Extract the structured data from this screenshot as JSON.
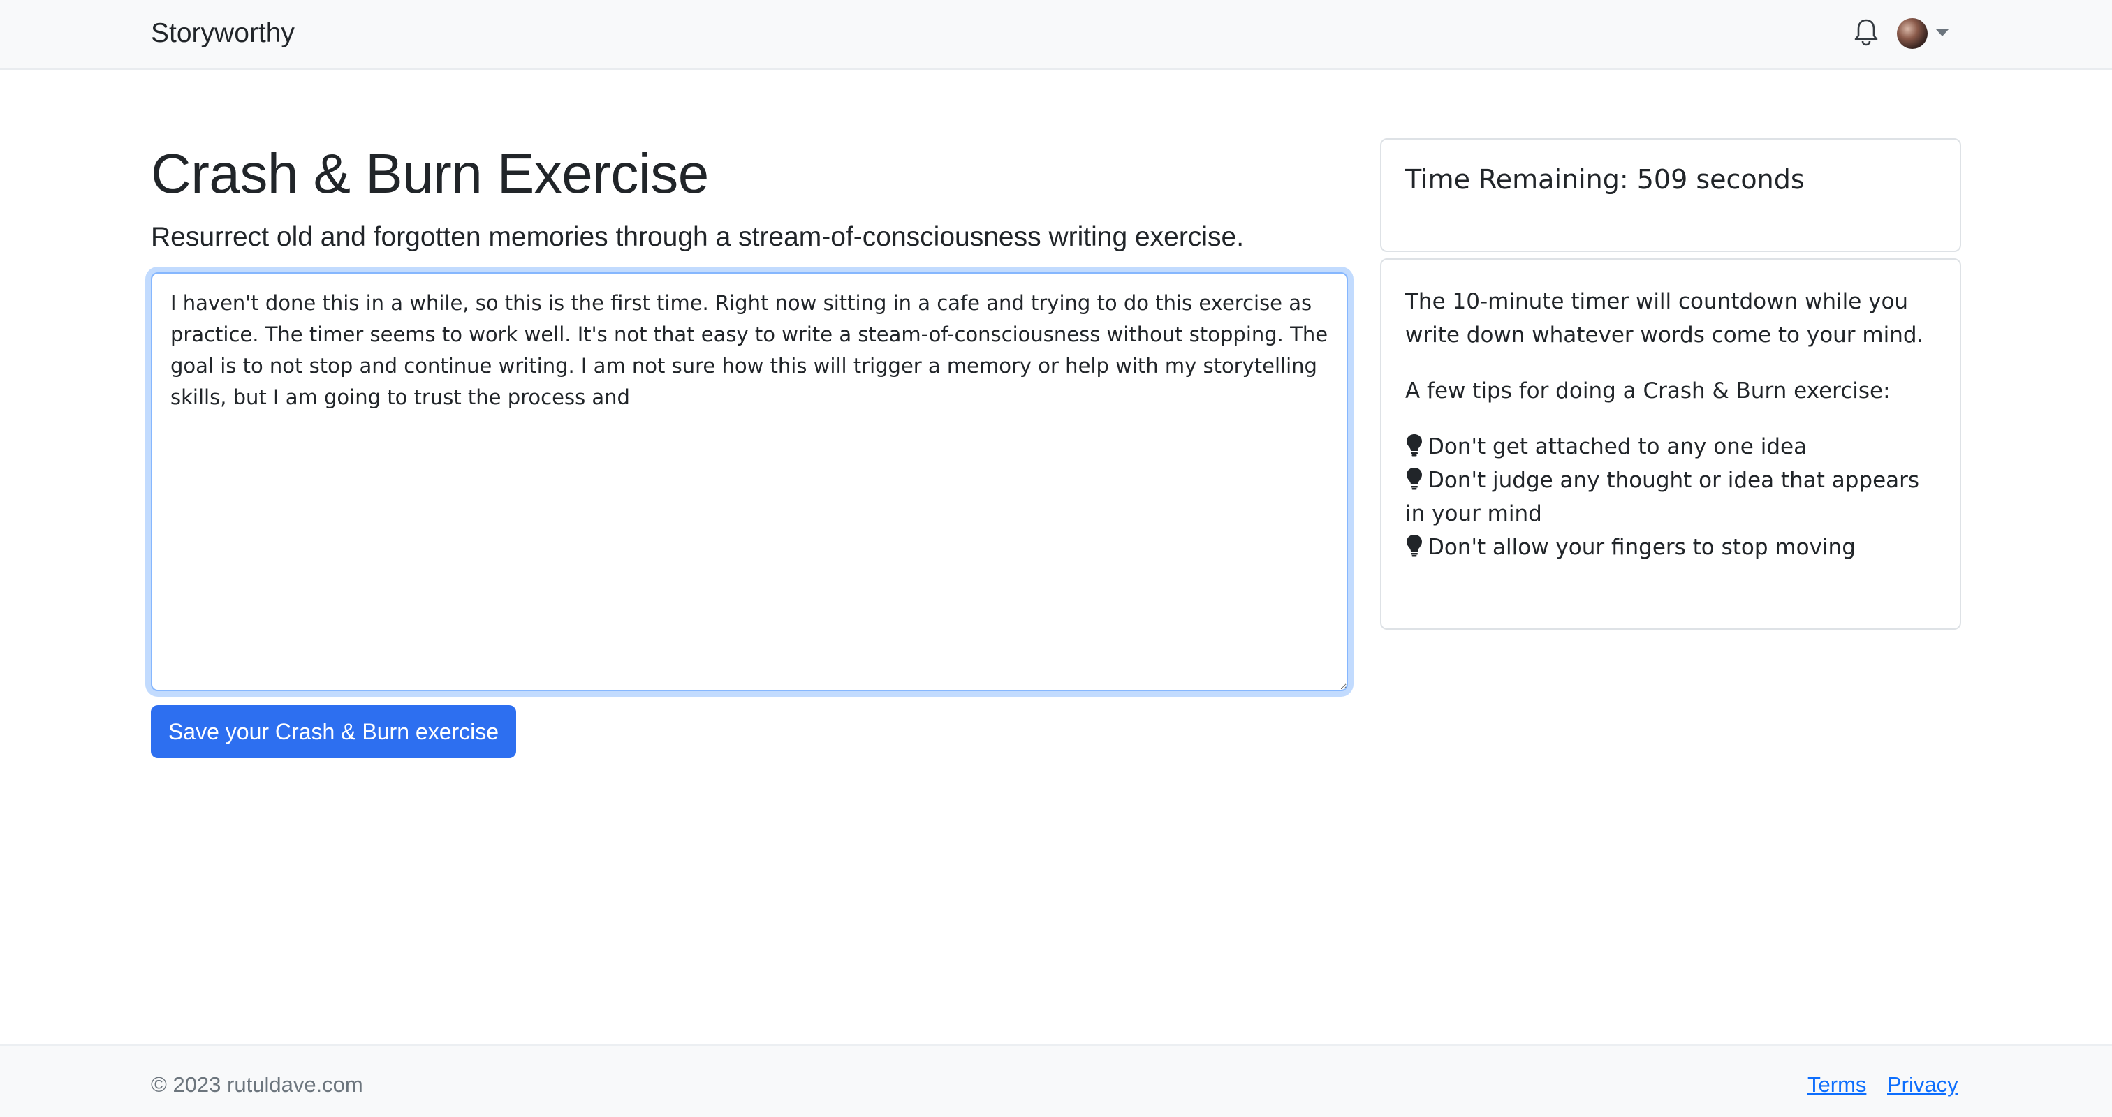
{
  "navbar": {
    "brand": "Storyworthy",
    "icons": {
      "notifications": "bell-icon",
      "profile": "avatar",
      "menu": "caret-down-icon"
    }
  },
  "main": {
    "title": "Crash & Burn Exercise",
    "lead": "Resurrect old and forgotten memories through a stream-of-consciousness writing exercise.",
    "editor_value": "I haven't done this in a while, so this is the first time. Right now sitting in a cafe and trying to do this exercise as practice. The timer seems to work well. It's not that easy to write a steam-of-consciousness without stopping. The goal is to not stop and continue writing. I am not sure how this will trigger a memory or help with my storytelling skills, but I am going to trust the process and ",
    "save_label": "Save your Crash & Burn exercise"
  },
  "sidebar": {
    "timer_text": "Time Remaining: 509 seconds",
    "intro": "The 10-minute timer will countdown while you write down whatever words come to your mind.",
    "tips_heading": "A few tips for doing a Crash & Burn exercise:",
    "tips": [
      "Don't get attached to any one idea",
      "Don't judge any thought or idea that appears in your mind",
      "Don't allow your fingers to stop moving"
    ],
    "tip_icon": "lightbulb-icon"
  },
  "footer": {
    "copyright": "© 2023 rutuldave.com",
    "terms": "Terms",
    "privacy": "Privacy"
  },
  "colors": {
    "primary": "#0d6efd",
    "navbar_bg": "#f8f9fa",
    "text": "#212529",
    "muted": "#6c757d"
  }
}
